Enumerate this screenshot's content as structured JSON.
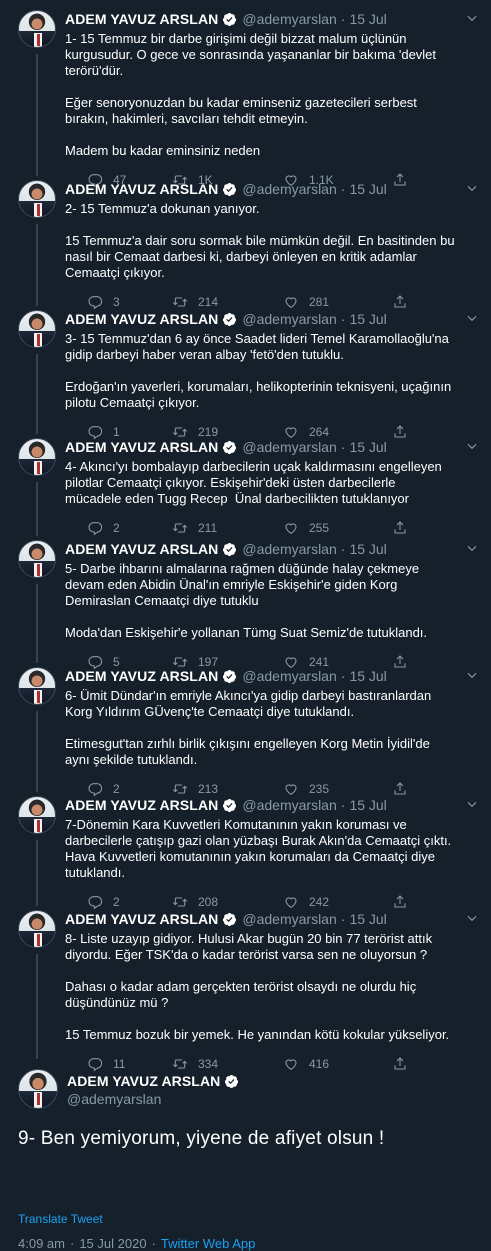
{
  "author": {
    "name": "ADEM YAVUZ ARSLAN",
    "handle": "@ademyarslan",
    "date": "15 Jul"
  },
  "colors": {
    "background": "#15202b",
    "accent": "#1da1f2",
    "muted": "#8899a6"
  },
  "tweets": [
    {
      "lines": [
        "1- 15 Temmuz bir darbe girişimi değil bizzat malum üçlünün",
        "kurgusudur. O gece ve sonrasında yaşananlar bir bakıma 'devlet",
        "terörü'dür.",
        "",
        "Eğer senoryonuzdan bu kadar eminseniz gazetecileri serbest",
        "bırakın, hakimleri, savcıları tehdit etmeyin.",
        "",
        "Madem bu kadar eminsiniz neden"
      ],
      "replies": "47",
      "retweets": "1K",
      "likes": "1.1K"
    },
    {
      "lines": [
        "2- 15 Temmuz'a dokunan yanıyor.",
        "",
        "15 Temmuz'a dair soru sormak bile mümkün değil. En basitinden bu",
        "nasıl bir Cemaat darbesi ki, darbeyi önleyen en kritik adamlar",
        "Cemaatçi çıkıyor."
      ],
      "replies": "3",
      "retweets": "214",
      "likes": "281"
    },
    {
      "lines": [
        "3- 15 Temmuz'dan 6 ay önce Saadet lideri Temel Karamollaoğlu'na",
        "gidip darbeyi haber veran albay 'fetö'den tutuklu.",
        "",
        "Erdoğan'ın yaverleri, korumaları, helikopterinin teknisyeni, uçağının",
        "pilotu Cemaatçi çıkıyor."
      ],
      "replies": "1",
      "retweets": "219",
      "likes": "264"
    },
    {
      "lines": [
        "4- Akıncı'yı bombalayıp darbecilerin uçak kaldırmasını engelleyen",
        "pilotlar Cemaatçi çıkıyor. Eskişehir'deki üsten darbecilerle",
        "mücadele eden Tugg Recep  Ünal darbecilikten tutuklanıyor"
      ],
      "replies": "2",
      "retweets": "211",
      "likes": "255"
    },
    {
      "lines": [
        "5- Darbe ihbarını almalarına rağmen düğünde halay çekmeye",
        "devam eden Abidin Ünal'ın emriyle Eskişehir'e giden Korg",
        "Demiraslan Cemaatçi diye tutuklu",
        "",
        "Moda'dan Eskişehir'e yollanan Tümg Suat Semiz'de tutuklandı."
      ],
      "replies": "5",
      "retweets": "197",
      "likes": "241"
    },
    {
      "lines": [
        "6- Ümit Dündar'ın emriyle Akıncı'ya gidip darbeyi bastıranlardan",
        "Korg Yıldırım GÜvenç'te Cemaatçi diye tutuklandı.",
        "",
        "Etimesgut'tan zırhlı birlik çıkışını engelleyen Korg Metin İyidil'de",
        "aynı şekilde tutuklandı."
      ],
      "replies": "2",
      "retweets": "213",
      "likes": "235"
    },
    {
      "lines": [
        "7-Dönemin Kara Kuvvetleri Komutanının yakın koruması ve",
        "darbecilerle çatışıp gazi olan yüzbaşı Burak Akın'da Cemaatçi çıktı.",
        "Hava Kuvvetleri komutanının yakın korumaları da Cemaatçi diye",
        "tutuklandı."
      ],
      "replies": "2",
      "retweets": "208",
      "likes": "242"
    },
    {
      "lines": [
        "8- Liste uzayıp gidiyor. Hulusi Akar bugün 20 bin 77 terörist attık",
        "diyordu. Eğer TSK'da o kadar terörist varsa sen ne oluyorsun ?",
        "",
        "Dahası o kadar adam gerçekten terörist olsaydı ne olurdu hiç",
        "düşündünüz mü ?",
        "",
        "15 Temmuz bozuk bir yemek. He yanından kötü kokular yükseliyor."
      ],
      "replies": "11",
      "retweets": "334",
      "likes": "416"
    }
  ],
  "main_tweet": {
    "name": "ADEM YAVUZ ARSLAN",
    "handle": "@ademyarslan",
    "text": "9- Ben yemiyorum, yiyene de afiyet olsun !",
    "translate_label": "Translate Tweet",
    "time": "4:09 am",
    "date": "15 Jul 2020",
    "app": "Twitter Web App"
  }
}
